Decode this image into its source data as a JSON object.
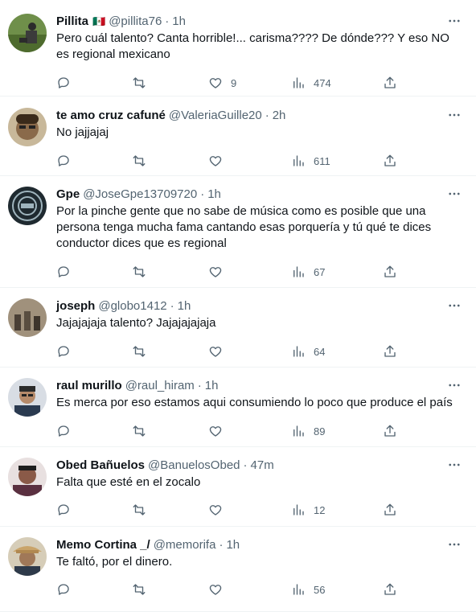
{
  "tweets": [
    {
      "name": "Pillita",
      "flag": "🇲🇽",
      "handle": "@pillita76",
      "time": "1h",
      "text": "Pero cuál talento? Canta horrible!... carisma???? De dónde??? Y eso NO es regional mexicano",
      "likes": "9",
      "views": "474",
      "avatar_color": "#5a7a3a"
    },
    {
      "name": "te amo cruz cafuné",
      "handle": "@ValeriaGuille20",
      "time": "2h",
      "text": "No jajjajaj",
      "likes": "",
      "views": "611",
      "avatar_color": "#8a7a5a"
    },
    {
      "name": "Gpe",
      "handle": "@JoseGpe13709720",
      "time": "1h",
      "text": "Por la pinche gente que no sabe de música como es posible que una persona tenga mucha fama cantando esas porquería y tú qué te dices conductor dices que es regional",
      "likes": "",
      "views": "67",
      "avatar_color": "#1f2a30"
    },
    {
      "name": "joseph",
      "handle": "@globo1412",
      "time": "1h",
      "text": "Jajajajaja talento? Jajajajajaja",
      "likes": "",
      "views": "64",
      "avatar_color": "#7a6e5e"
    },
    {
      "name": "raul murillo",
      "handle": "@raul_hiram",
      "time": "1h",
      "text": "Es merca por eso estamos aqui consumiendo lo poco que produce el país",
      "likes": "",
      "views": "89",
      "avatar_color": "#3a4a60"
    },
    {
      "name": "Obed Bañuelos",
      "handle": "@BanuelosObed",
      "time": "47m",
      "text": "Falta que esté en el zocalo",
      "likes": "",
      "views": "12",
      "avatar_color": "#6a4a4a"
    },
    {
      "name": "Memo Cortina _/",
      "handle": "@memorifa",
      "time": "1h",
      "text": "Te faltó, por el dinero.",
      "likes": "",
      "views": "56",
      "avatar_color": "#9a7a50"
    }
  ]
}
